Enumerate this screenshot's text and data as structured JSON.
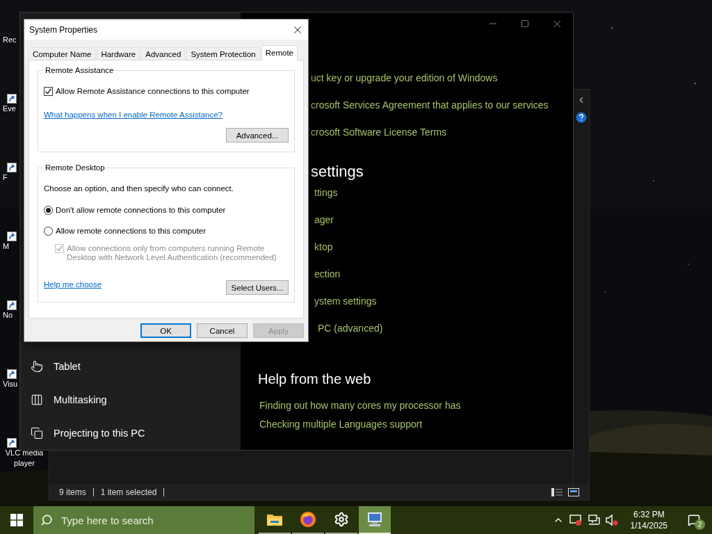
{
  "desktop_icons": [
    {
      "label": "Rec",
      "shortcut": false
    },
    {
      "label": "Eve",
      "shortcut": true
    },
    {
      "label": "F",
      "shortcut": true
    },
    {
      "label": "M",
      "shortcut": true
    },
    {
      "label": "No",
      "shortcut": true
    },
    {
      "label": "Visu",
      "shortcut": true
    },
    {
      "label": "VLC media player",
      "shortcut": true
    }
  ],
  "explorer_window": {
    "status_bar": {
      "item_count": "9 items",
      "selection": "1 item selected"
    }
  },
  "settings_window": {
    "sidebar": {
      "items": [
        {
          "label": "Tablet",
          "kind": "tablet"
        },
        {
          "label": "Multitasking",
          "kind": "multitasking"
        },
        {
          "label": "Projecting to this PC",
          "kind": "projecting"
        }
      ]
    },
    "content": {
      "top_links": [
        "uct key or upgrade your edition of Windows",
        "crosoft Services Agreement that applies to our services",
        "crosoft Software License Terms"
      ],
      "section_heading": "settings",
      "section_links": [
        "ttings",
        "ager",
        "ktop",
        "ection",
        "ystem settings",
        "PC (advanced)"
      ],
      "help_heading": "Help from the web",
      "help_links": [
        "Finding out how many cores my processor has",
        "Checking multiple Languages support"
      ]
    }
  },
  "dialog": {
    "title": "System Properties",
    "tabs": [
      {
        "label": "Computer Name",
        "selected": false
      },
      {
        "label": "Hardware",
        "selected": false
      },
      {
        "label": "Advanced",
        "selected": false
      },
      {
        "label": "System Protection",
        "selected": false
      },
      {
        "label": "Remote",
        "selected": true
      }
    ],
    "remote_assistance": {
      "legend": "Remote Assistance",
      "checkbox": {
        "label": "Allow Remote Assistance connections to this computer",
        "checked": true
      },
      "link": "What happens when I enable Remote Assistance?",
      "button": "Advanced..."
    },
    "remote_desktop": {
      "legend": "Remote Desktop",
      "intro": "Choose an option, and then specify who can connect.",
      "options": [
        {
          "label": "Don't allow remote connections to this computer",
          "selected": true
        },
        {
          "label": "Allow remote connections to this computer",
          "selected": false
        }
      ],
      "nla": {
        "label": "Allow connections only from computers running Remote Desktop with Network Level Authentication (recommended)",
        "checked": true,
        "disabled": true
      },
      "link": "Help me choose",
      "button": "Select Users..."
    },
    "buttons": [
      {
        "label": "OK",
        "default": true,
        "disabled": false
      },
      {
        "label": "Cancel",
        "default": false,
        "disabled": false
      },
      {
        "label": "Apply",
        "default": false,
        "disabled": true
      }
    ]
  },
  "taskbar": {
    "search": {
      "placeholder": "Type here to search"
    },
    "apps": [
      {
        "kind": "folder",
        "selected": false
      },
      {
        "kind": "browser",
        "selected": false
      },
      {
        "kind": "gear",
        "selected": false
      },
      {
        "kind": "computer",
        "selected": true
      }
    ],
    "tray_icons": [
      {
        "kind": "security"
      },
      {
        "kind": "network"
      },
      {
        "kind": "volume"
      }
    ],
    "clock": {
      "time": "6:32 PM",
      "date": "1/14/2025"
    },
    "notifications": {
      "badge": "2"
    }
  }
}
